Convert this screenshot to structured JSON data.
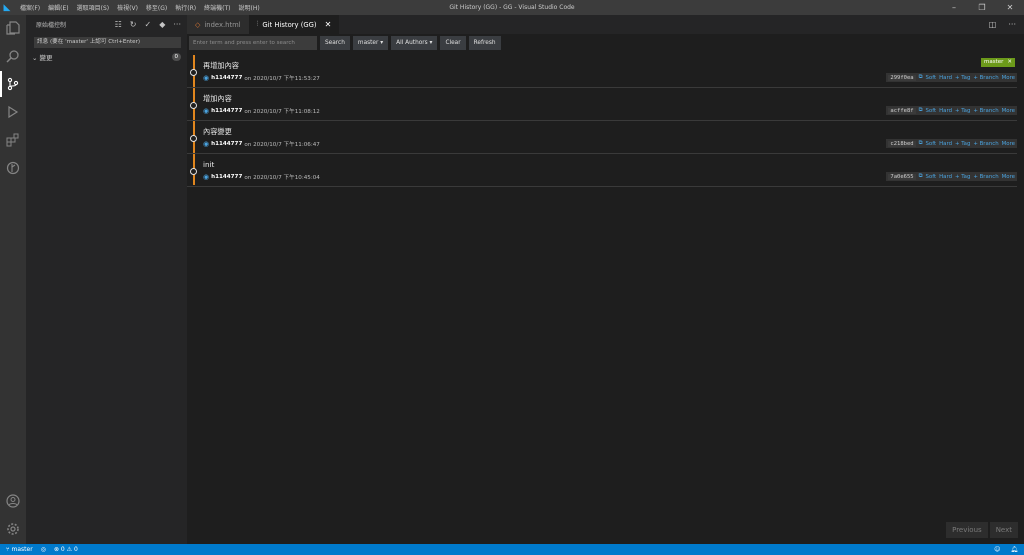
{
  "window": {
    "title": "Git History (GG) - GG - Visual Studio Code",
    "menu": [
      "檔案(F)",
      "編輯(E)",
      "選取項目(S)",
      "檢視(V)",
      "移至(G)",
      "執行(R)",
      "終端機(T)",
      "說明(H)"
    ]
  },
  "sidebar": {
    "title": "原始檔控制",
    "commit_placeholder": "訊息 (要在 'master' 上認可 Ctrl+Enter)",
    "changes_label": "變更",
    "changes_count": "0"
  },
  "tabs": [
    {
      "label": "index.html",
      "icon": "html-file-icon"
    },
    {
      "label": "Git History (GG)",
      "icon": "git-history-icon"
    }
  ],
  "toolbar": {
    "search_placeholder": "Enter term and press enter to search",
    "search_button": "Search",
    "branch_button": "master ▾",
    "authors_button": "All Authors ▾",
    "clear_button": "Clear",
    "refresh_button": "Refresh"
  },
  "commits": [
    {
      "message": "再增加內容",
      "author": "h1144777",
      "date": "on 2020/10/7 下午11:53:27",
      "hash": "299f0ea",
      "branch": "master"
    },
    {
      "message": "增加內容",
      "author": "h1144777",
      "date": "on 2020/10/7 下午11:08:12",
      "hash": "acffe8f"
    },
    {
      "message": "內容變更",
      "author": "h1144777",
      "date": "on 2020/10/7 下午11:06:47",
      "hash": "c218bed"
    },
    {
      "message": "init",
      "author": "h1144777",
      "date": "on 2020/10/7 下午10:45:04",
      "hash": "7a0e655"
    }
  ],
  "commit_actions": {
    "soft": "Soft",
    "hard": "Hard",
    "tag": "+ Tag",
    "branch": "+ Branch",
    "more": "More"
  },
  "pager": {
    "previous": "Previous",
    "next": "Next"
  },
  "status": {
    "branch": "master",
    "errors": "0",
    "warnings": "0"
  },
  "colors": {
    "accent": "#007acc",
    "graph": "#e0861e",
    "branch_tag": "#6c9a1a"
  }
}
